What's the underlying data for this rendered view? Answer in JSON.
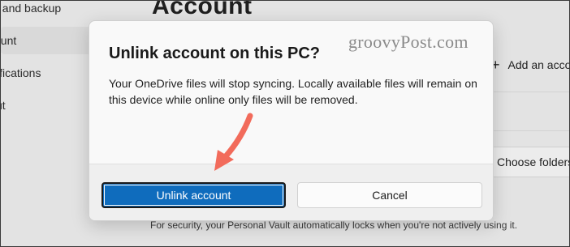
{
  "background": {
    "sidebar_items": [
      {
        "label": "t and backup"
      },
      {
        "label": "ount"
      },
      {
        "label": "ifications"
      },
      {
        "label": "ut"
      }
    ],
    "page_title": "Account",
    "add_account_label": "Add an acco",
    "choose_folders_label": "Choose folders",
    "footer_text": "For security, your Personal Vault automatically locks when you're not actively using it."
  },
  "watermark": "groovyPost.com",
  "dialog": {
    "title": "Unlink account on this PC?",
    "body": "Your OneDrive files will stop syncing. Locally available files will remain on this device while online only files will be removed.",
    "primary_button": "Unlink account",
    "secondary_button": "Cancel"
  },
  "colors": {
    "accent": "#0f6cbd",
    "arrow": "#f26b5b"
  }
}
